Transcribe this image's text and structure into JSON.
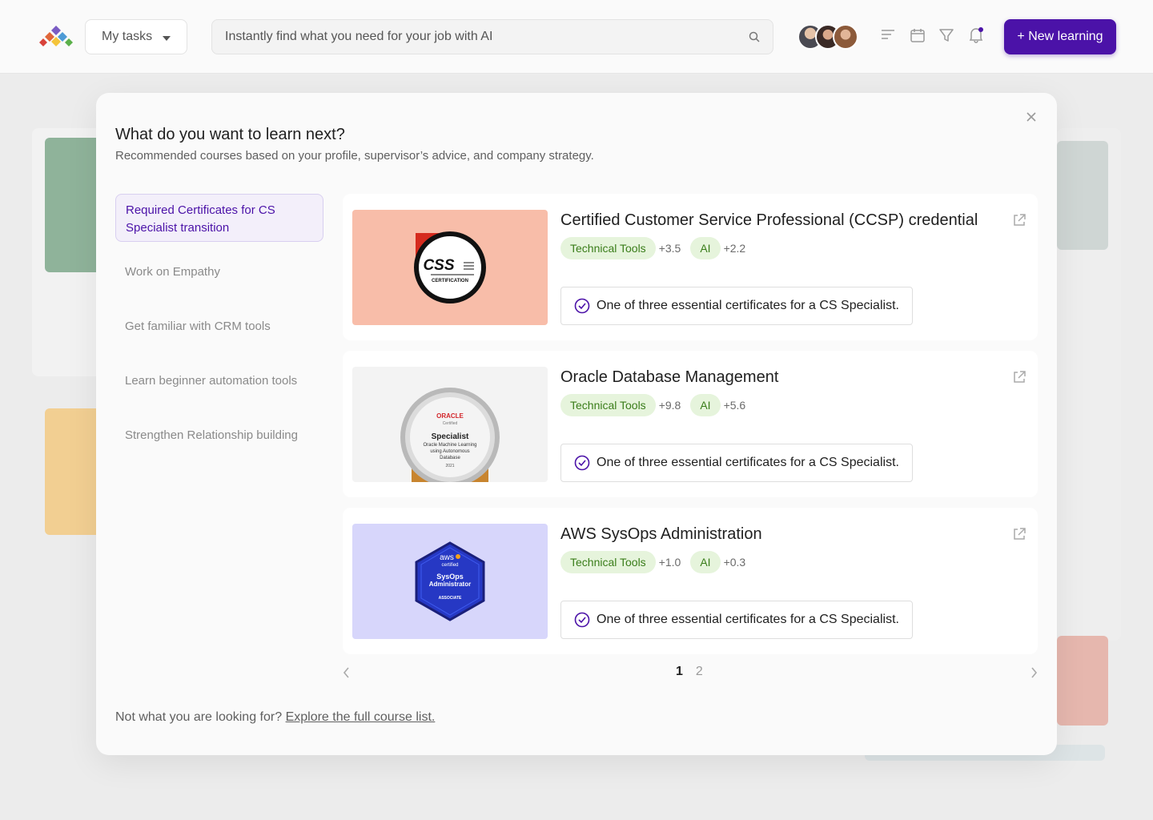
{
  "topbar": {
    "tasks_label": "My tasks",
    "search_placeholder": "Instantly find what you need for your job with AI",
    "new_button": "+ New learning",
    "icons": [
      "sort-icon",
      "calendar-icon",
      "filter-icon",
      "bell-icon"
    ],
    "accent": "#4b12a8"
  },
  "modal": {
    "title": "What do you want to learn next?",
    "subtitle": "Recommended courses based on your profile, supervisor’s advice, and company strategy.",
    "nav": [
      {
        "label": "Required Certificates for CS Specialist transition",
        "active": true
      },
      {
        "label": "Work on Empathy"
      },
      {
        "label": "Get familiar with CRM tools"
      },
      {
        "label": "Learn beginner automation tools"
      },
      {
        "label": "Strengthen Relationship building"
      }
    ],
    "courses": [
      {
        "title": "Certified Customer Service Professional (CCSP) credential",
        "tag1": "Technical Tools",
        "delta1": "+3.5",
        "tag2": "AI",
        "delta2": "+2.2",
        "note": "One of three essential certificates for a CS Specialist.",
        "thumb_bg": "#f8bda9",
        "badge": {
          "brand": "CSS",
          "caption": "CERTIFICATION"
        }
      },
      {
        "title": "Oracle Database Management",
        "tag1": "Technical Tools",
        "delta1": "+9.8",
        "tag2": "AI",
        "delta2": "+5.6",
        "note": "One of three essential certificates for a CS Specialist.",
        "thumb_bg": "#f3f3f3",
        "badge": {
          "brand": "ORACLE",
          "sub": "Certified",
          "role": "Specialist",
          "l1": "Oracle Machine Learning",
          "l2": "using Autonomous",
          "l3": "Database",
          "year": "2021"
        }
      },
      {
        "title": "AWS SysOps Administration",
        "tag1": "Technical Tools",
        "delta1": "+1.0",
        "tag2": "AI",
        "delta2": "+0.3",
        "note": "One of three essential certificates for a CS Specialist.",
        "thumb_bg": "#d7d6fb",
        "badge": {
          "brand": "aws",
          "sub": "certified",
          "l1": "SysOps",
          "l2": "Administrator",
          "level": "ASSOCIATE"
        }
      }
    ],
    "pager": {
      "current": "1",
      "other": "2"
    },
    "footer_text": "Not what you are looking for?",
    "footer_link": "Explore the full course list."
  }
}
